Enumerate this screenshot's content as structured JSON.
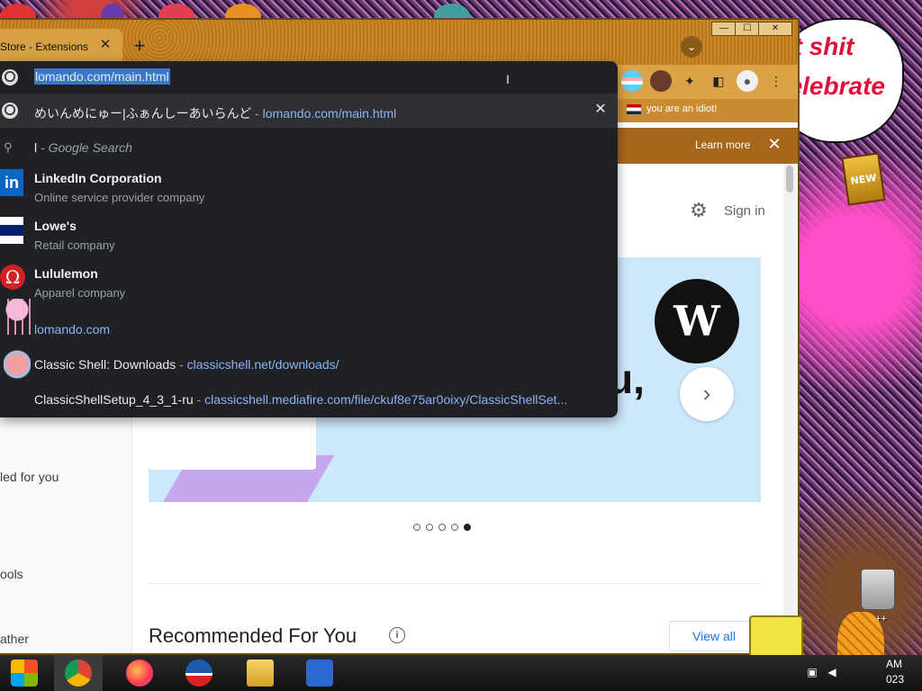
{
  "window": {
    "tab_title": "Store - Extensions",
    "tab_close": "✕",
    "new_tab": "+",
    "tab_search": "⌄",
    "controls": [
      "—",
      "☐",
      "✕"
    ]
  },
  "omnibox": {
    "input_value": "lomando.com/main.html",
    "top_row": {
      "title": "めいんめにゅー|ふぁんしーあいらんど",
      "separator": " - ",
      "url": "lomando.com/main.html",
      "remove": "✕"
    },
    "search_row": {
      "query": "l",
      "suffix": " - Google Search"
    },
    "entities": [
      {
        "name": "LinkedIn Corporation",
        "desc": "Online service provider company",
        "logo": "linkedin-logo"
      },
      {
        "name": "Lowe's",
        "desc": "Retail company",
        "logo": "lowes-logo"
      },
      {
        "name": "Lululemon",
        "desc": "Apparel company",
        "logo": "lululemon-logo"
      }
    ],
    "links": [
      {
        "title": "",
        "separator": "",
        "url": "lomando.com"
      },
      {
        "title": "Classic Shell: Downloads",
        "separator": " - ",
        "url": "classicshell.net/downloads/"
      },
      {
        "title": "ClassicShellSetup_4_3_1-ru",
        "separator": " - ",
        "url": "classicshell.mediafire.com/file/ckuf8e75ar0oixy/ClassicShellSet..."
      }
    ]
  },
  "bookmarks": {
    "item": "you are an idiot!"
  },
  "infobar": {
    "learn_more": "Learn more",
    "close": "✕"
  },
  "page": {
    "sign_in": "Sign in",
    "left_nav": [
      "led for you",
      "ools",
      "ather"
    ],
    "hero_text": "u,",
    "hero_logo": "W",
    "hero_next": "›",
    "carousel": {
      "count": 5,
      "active": 5
    },
    "recommended_title": "Recommended For You",
    "info_icon": "i",
    "view_all": "View all"
  },
  "desktop": {
    "wall_line1": "at shit",
    "wall_line2": "celebrate",
    "new_badge": "NEW",
    "trash_label": "n C++"
  },
  "taskbar": {
    "clock_line1": "AM",
    "clock_line2": "023"
  },
  "colors": {
    "omnibox_bg": "#202124",
    "link_blue": "#8ab4f8",
    "titlebar": "#c48326",
    "page_accent": "#1a73e8"
  }
}
